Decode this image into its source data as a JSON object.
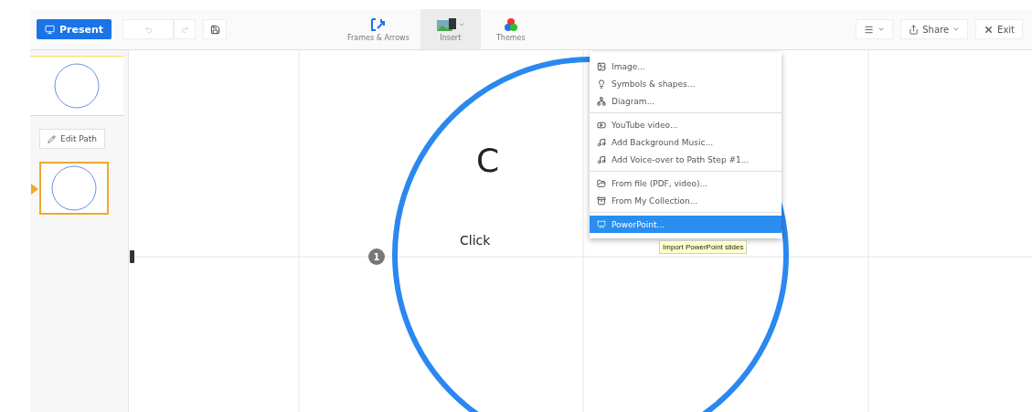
{
  "toolbar": {
    "present": "Present",
    "tools": [
      {
        "kind": "frames",
        "label": "Frames & Arrows",
        "selected": false
      },
      {
        "kind": "insert",
        "label": "Insert",
        "selected": true
      },
      {
        "kind": "themes",
        "label": "Themes",
        "selected": false
      }
    ],
    "share": "Share",
    "exit": "Exit"
  },
  "sidebar": {
    "steps": [
      {
        "selected": false
      },
      {
        "selected": true
      }
    ],
    "edit_path": "Edit Path"
  },
  "canvas": {
    "title_fragment": "C",
    "body_fragment": "Click",
    "step_number": "1"
  },
  "insert_menu": {
    "groups": [
      {
        "items": [
          {
            "kind": "image",
            "label": "Image...",
            "selected": false
          },
          {
            "kind": "symbols",
            "label": "Symbols & shapes...",
            "selected": false
          },
          {
            "kind": "diagram",
            "label": "Diagram...",
            "selected": false
          }
        ]
      },
      {
        "items": [
          {
            "kind": "youtube",
            "label": "YouTube video...",
            "selected": false
          },
          {
            "kind": "music",
            "label": "Add Background Music...",
            "selected": false
          },
          {
            "kind": "voice",
            "label": "Add Voice-over to Path Step #1...",
            "selected": false
          }
        ]
      },
      {
        "items": [
          {
            "kind": "file",
            "label": "From file (PDF, video)...",
            "selected": false
          },
          {
            "kind": "collection",
            "label": "From My Collection...",
            "selected": false
          }
        ]
      },
      {
        "items": [
          {
            "kind": "powerpoint",
            "label": "PowerPoint...",
            "selected": true
          }
        ]
      }
    ],
    "tooltip": "Import PowerPoint slides"
  }
}
